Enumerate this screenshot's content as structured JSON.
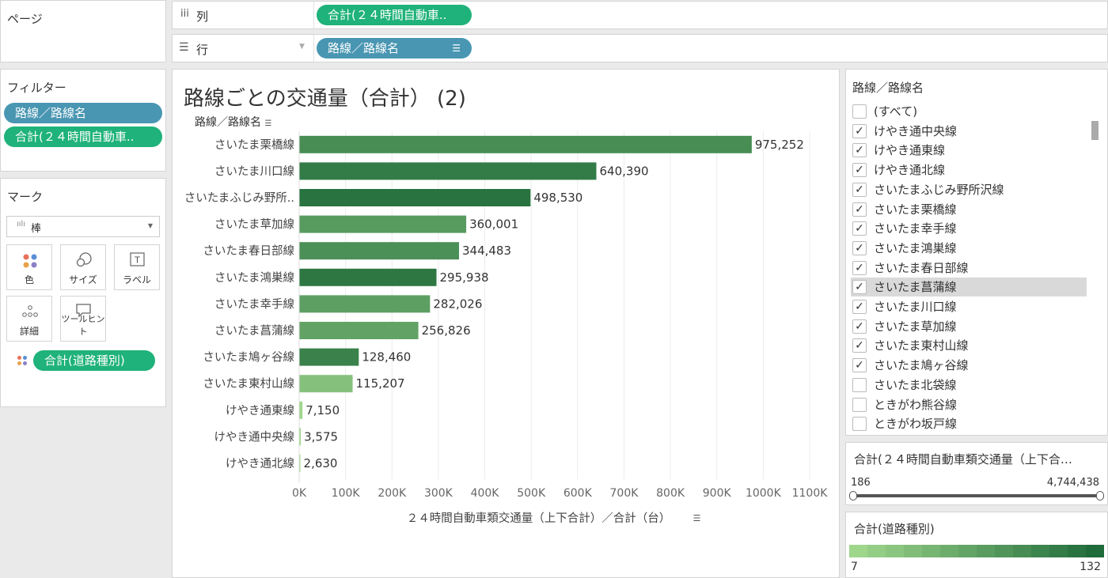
{
  "pages_shelf": {
    "label": "ページ"
  },
  "columns_shelf": {
    "icon": "iii",
    "label": "列",
    "pill": "合計(２４時間自動車.."
  },
  "rows_shelf": {
    "icon": "☰",
    "label": "行",
    "pill": "路線／路線名"
  },
  "filters_panel": {
    "title": "フィルター",
    "pills": [
      "路線／路線名",
      "合計(２４時間自動車.."
    ]
  },
  "marks_panel": {
    "title": "マーク",
    "mark_type": "棒",
    "cards": [
      {
        "label": "色",
        "icon": "color-icon"
      },
      {
        "label": "サイズ",
        "icon": "size-icon"
      },
      {
        "label": "ラベル",
        "icon": "label-icon"
      },
      {
        "label": "詳細",
        "icon": "detail-icon"
      },
      {
        "label": "ツールヒント",
        "icon": "tooltip-icon"
      }
    ],
    "color_pill": "合計(道路種別)"
  },
  "chart": {
    "title": "路線ごとの交通量（合計） (2)",
    "row_header": "路線／路線名"
  },
  "chart_data": {
    "type": "bar",
    "orientation": "horizontal",
    "title": "路線ごとの交通量（合計） (2)",
    "ylabel": "路線／路線名",
    "xlabel": "２４時間自動車類交通量（上下合計）／合計（台）",
    "categories": [
      "さいたま栗橋線",
      "さいたま川口線",
      "さいたまふじみ野所..",
      "さいたま草加線",
      "さいたま春日部線",
      "さいたま鴻巣線",
      "さいたま幸手線",
      "さいたま菖蒲線",
      "さいたま鳩ヶ谷線",
      "さいたま東村山線",
      "けやき通東線",
      "けやき通中央線",
      "けやき通北線"
    ],
    "values": [
      975252,
      640390,
      498530,
      360001,
      344483,
      295938,
      282026,
      256826,
      128460,
      115207,
      7150,
      3575,
      2630
    ],
    "value_labels": [
      "975,252",
      "640,390",
      "498,530",
      "360,001",
      "344,483",
      "295,938",
      "282,026",
      "256,826",
      "128,460",
      "115,207",
      "7,150",
      "3,575",
      "2,630"
    ],
    "color_values": [
      65,
      95,
      115,
      45,
      60,
      105,
      40,
      35,
      85,
      12,
      7,
      7,
      7
    ],
    "x_ticks": [
      "0K",
      "100K",
      "200K",
      "300K",
      "400K",
      "500K",
      "600K",
      "700K",
      "800K",
      "900K",
      "1000K",
      "1100K"
    ],
    "xlim": [
      0,
      1100000
    ],
    "grid": true,
    "colors": {
      "low": "#9ed68c",
      "high": "#1f6b3a"
    }
  },
  "route_filter": {
    "title": "路線／路線名",
    "items": [
      {
        "label": "(すべて)",
        "checked": false
      },
      {
        "label": "けやき通中央線",
        "checked": true
      },
      {
        "label": "けやき通東線",
        "checked": true
      },
      {
        "label": "けやき通北線",
        "checked": true
      },
      {
        "label": "さいたまふじみ野所沢線",
        "checked": true
      },
      {
        "label": "さいたま栗橋線",
        "checked": true
      },
      {
        "label": "さいたま幸手線",
        "checked": true
      },
      {
        "label": "さいたま鴻巣線",
        "checked": true
      },
      {
        "label": "さいたま春日部線",
        "checked": true
      },
      {
        "label": "さいたま菖蒲線",
        "checked": true,
        "hover": true
      },
      {
        "label": "さいたま川口線",
        "checked": true
      },
      {
        "label": "さいたま草加線",
        "checked": true
      },
      {
        "label": "さいたま東村山線",
        "checked": true
      },
      {
        "label": "さいたま鳩ヶ谷線",
        "checked": true
      },
      {
        "label": "さいたま北袋線",
        "checked": false
      },
      {
        "label": "ときがわ熊谷線",
        "checked": false
      },
      {
        "label": "ときがわ坂戸線",
        "checked": false
      }
    ]
  },
  "range_filter": {
    "title": "合計(２４時間自動車類交通量（上下合…",
    "min_label": "186",
    "max_label": "4,744,438"
  },
  "color_legend": {
    "title": "合計(道路種別)",
    "min_label": "7",
    "max_label": "132"
  }
}
